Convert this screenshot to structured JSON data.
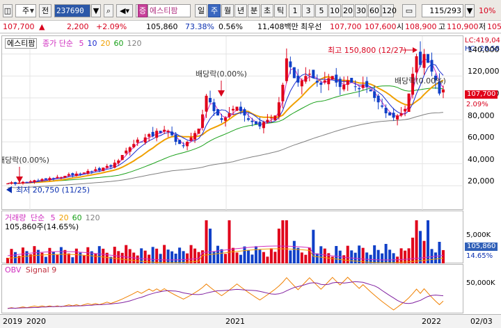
{
  "toolbar": {
    "period_select": "주",
    "prev_label": "전",
    "stock_code": "237690",
    "stock_type_badge": "증",
    "stock_name": "에스티팜",
    "tabs": [
      "일",
      "주",
      "월",
      "년",
      "분",
      "초",
      "틱"
    ],
    "selected_tab": "주",
    "intervals": [
      "1",
      "3",
      "5",
      "10",
      "20",
      "30",
      "60",
      "120"
    ],
    "count_value": "115",
    "count_total": "/293",
    "right_value": "10%"
  },
  "price_bar": {
    "price": "107,700",
    "change": "2,200",
    "change_pct": "+2.09%",
    "volume": "105,860",
    "vol_ratio": "73.38%",
    "turnover": "0.56%",
    "amount": "11,408백만",
    "bid_label": "최우선",
    "ask_price": "107,700",
    "bid_price": "107,600",
    "open_label": "시",
    "open_price": "108,900",
    "high_label": "고",
    "high_price": "110,900",
    "low_label": "저",
    "low_price": "105"
  },
  "price_panel": {
    "stock_name": "에스티팜",
    "ma_title": "종가 단순",
    "ma_periods": [
      "5",
      "10",
      "20",
      "60",
      "120"
    ],
    "lc_label": "LC:419,04",
    "hc_label": "HC:-28,58",
    "y_ticks": [
      "140,000",
      "120,000",
      "100,000",
      "80,000",
      "60,000",
      "40,000",
      "20,000"
    ],
    "current_tag": "107,700",
    "pct_tag": "2.09%",
    "annotations": {
      "high": "최고 150,800 (12/27)",
      "low": "최저 20,750 (11/25)",
      "div1": "배당락(0.00%)",
      "div2": "배당락(0.00%)",
      "div3": "배당락(0.00%)"
    }
  },
  "volume_panel": {
    "title": "거래량",
    "ma_title": "단순",
    "ma_periods": [
      "5",
      "20",
      "60",
      "120"
    ],
    "value_text": "105,860주(14.65%)",
    "y_ticks": [
      "5,000K"
    ],
    "current_tag": "105,860",
    "pct_tag": "14.65%"
  },
  "obv_panel": {
    "title": "OBV",
    "signal": "Signal 9",
    "y_ticks": [
      "50,000K"
    ]
  },
  "x_axis": {
    "labels": [
      "2019",
      "2020",
      "2021",
      "2022",
      "02/03"
    ]
  },
  "colors": {
    "up": "#e0001a",
    "down": "#1040c8",
    "ma5": "#d030c0",
    "ma10": "#1a2bd0",
    "ma20": "#f0a000",
    "ma60": "#18a018",
    "ma120": "#808080"
  },
  "chart_data": {
    "type": "candlestick",
    "period": "weekly",
    "y_range": [
      20000,
      150000
    ],
    "current_close": 107700,
    "high": {
      "value": 150800,
      "date": "12/27"
    },
    "low": {
      "value": 20750,
      "date": "11/25"
    },
    "weekly_close": [
      22000,
      23000,
      21500,
      22500,
      23500,
      22800,
      24000,
      25000,
      24500,
      26000,
      25500,
      27000,
      26500,
      28000,
      27500,
      29000,
      30500,
      29500,
      31000,
      30500,
      32000,
      33500,
      33000,
      35000,
      34000,
      36500,
      38000,
      37500,
      41000,
      43000,
      48000,
      52000,
      55000,
      58000,
      62000,
      60000,
      64000,
      67000,
      65000,
      70000,
      68000,
      71000,
      70000,
      66000,
      60000,
      58000,
      56000,
      60000,
      64000,
      68000,
      72000,
      85000,
      102000,
      96000,
      88000,
      84000,
      80000,
      82000,
      86000,
      90000,
      92000,
      88000,
      84000,
      80000,
      78000,
      76000,
      74000,
      78000,
      80000,
      82000,
      84000,
      96000,
      112000,
      136000,
      128000,
      118000,
      114000,
      116000,
      120000,
      122000,
      118000,
      114000,
      112000,
      116000,
      118000,
      120000,
      114000,
      110000,
      112000,
      116000,
      114000,
      110000,
      108000,
      112000,
      110000,
      106000,
      100000,
      96000,
      92000,
      86000,
      84000,
      82000,
      84000,
      86000,
      90000,
      104000,
      122000,
      138000,
      130000,
      140000,
      132000,
      124000,
      116000,
      104000,
      107700
    ]
  }
}
